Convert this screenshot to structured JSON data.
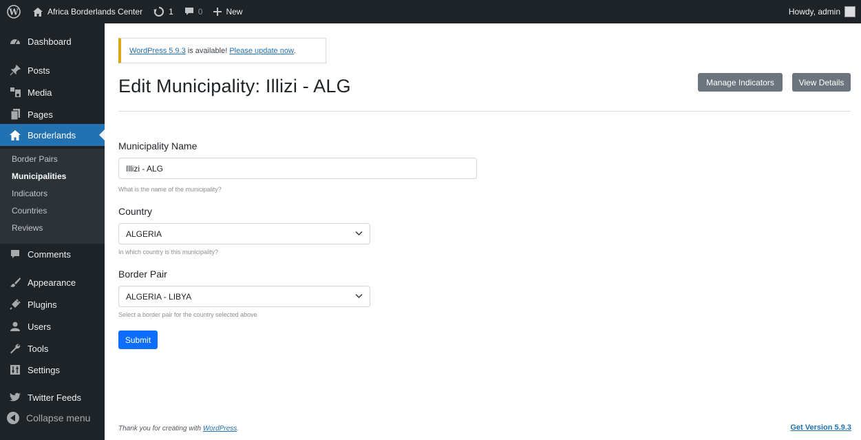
{
  "admin_bar": {
    "site_name": "Africa Borderlands Center",
    "updates_count": "1",
    "comments_count": "0",
    "new_label": "New",
    "howdy": "Howdy, admin"
  },
  "sidebar": {
    "items": [
      {
        "label": "Dashboard",
        "icon": "dashboard-icon"
      },
      {
        "label": "Posts",
        "icon": "pin-icon"
      },
      {
        "label": "Media",
        "icon": "media-icon"
      },
      {
        "label": "Pages",
        "icon": "pages-icon"
      },
      {
        "label": "Borderlands",
        "icon": "home-icon"
      },
      {
        "label": "Comments",
        "icon": "comment-icon"
      },
      {
        "label": "Appearance",
        "icon": "brush-icon"
      },
      {
        "label": "Plugins",
        "icon": "plugin-icon"
      },
      {
        "label": "Users",
        "icon": "users-icon"
      },
      {
        "label": "Tools",
        "icon": "wrench-icon"
      },
      {
        "label": "Settings",
        "icon": "settings-icon"
      },
      {
        "label": "Twitter Feeds",
        "icon": "twitter-icon"
      }
    ],
    "submenu": [
      "Border Pairs",
      "Municipalities",
      "Indicators",
      "Countries",
      "Reviews"
    ],
    "active_submenu": "Municipalities",
    "collapse_label": "Collapse menu"
  },
  "notice": {
    "version_link": "WordPress 5.9.3",
    "middle_text": " is available! ",
    "update_link": "Please update now",
    "end_text": "."
  },
  "page": {
    "title": "Edit Municipality: Illizi - ALG",
    "manage_button": "Manage Indicators",
    "details_button": "View Details"
  },
  "form": {
    "name_label": "Municipality Name",
    "name_value": "Illizi - ALG",
    "name_help": "What is the name of the municipality?",
    "country_label": "Country",
    "country_value": "ALGERIA",
    "country_help": "In which country is this municipality?",
    "border_label": "Border Pair",
    "border_value": "ALGERIA - LIBYA",
    "border_help": "Select a border pair for the country selected above",
    "submit_label": "Submit"
  },
  "footer": {
    "thanks_text": "Thank you for creating with ",
    "wordpress_link": "WordPress",
    "end_text": ".",
    "version_link": "Get Version 5.9.3"
  },
  "colors": {
    "admin_dark": "#1d2327",
    "accent_blue": "#2271b1",
    "submit_blue": "#0d6efd",
    "button_gray": "#6c757d",
    "notice_yellow": "#dba617"
  }
}
